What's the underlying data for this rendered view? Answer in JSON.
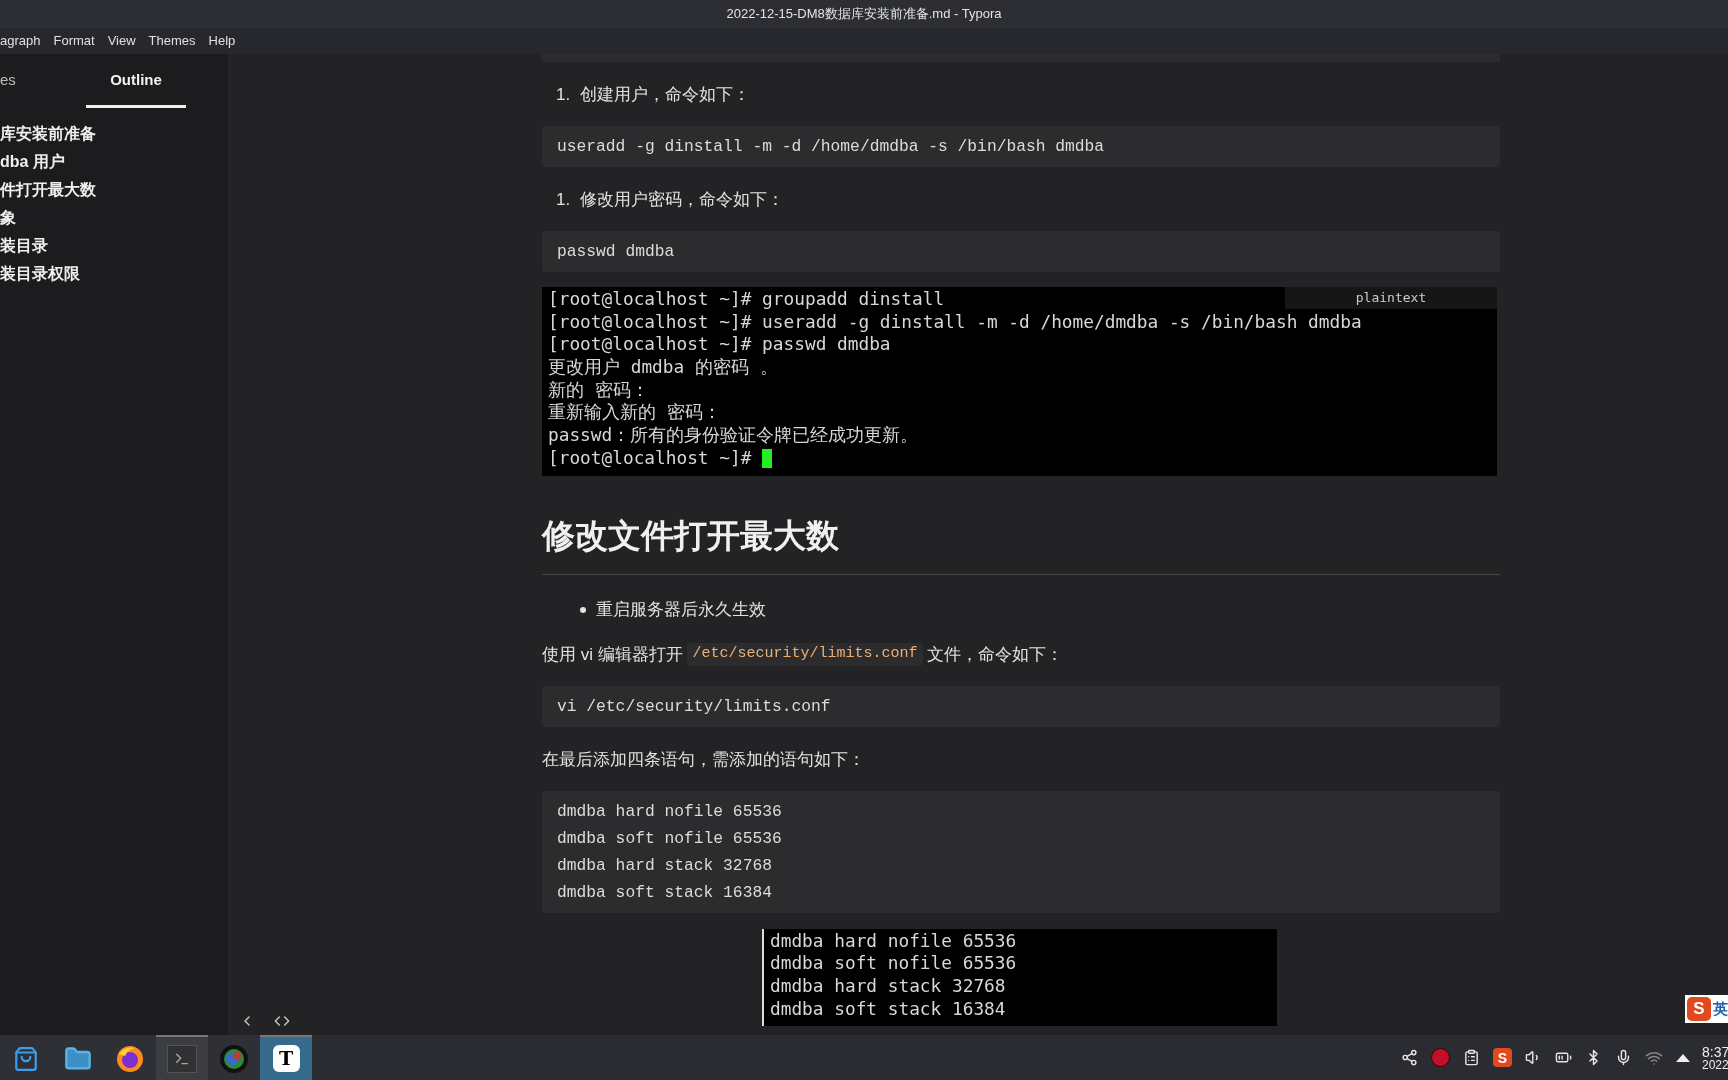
{
  "window": {
    "title": "2022-12-15-DM8数据库安装前准备.md - Typora"
  },
  "menu": [
    "agraph",
    "Format",
    "View",
    "Themes",
    "Help"
  ],
  "sidebar": {
    "tabs": [
      {
        "label": "es",
        "selected": false
      },
      {
        "label": "Outline",
        "selected": true
      }
    ],
    "outline": [
      "库安装前准备",
      "dba 用户",
      "件打开最大数",
      "象",
      "装目录",
      "装目录权限"
    ]
  },
  "document": {
    "blocks": [
      {
        "kind": "code_tail"
      },
      {
        "kind": "list_item",
        "number": "1.",
        "text": "创建用户，命令如下："
      },
      {
        "kind": "code",
        "lines": [
          "useradd -g dinstall -m -d /home/dmdba -s /bin/bash dmdba"
        ]
      },
      {
        "kind": "list_item",
        "number": "1.",
        "text": "修改用户密码，命令如下："
      },
      {
        "kind": "code",
        "lines": [
          "passwd dmdba"
        ]
      },
      {
        "kind": "terminal",
        "label": "plaintext",
        "cursor": true,
        "lines": [
          "[root@localhost ~]# groupadd dinstall",
          "[root@localhost ~]# useradd -g dinstall -m -d /home/dmdba -s /bin/bash dmdba",
          "[root@localhost ~]# passwd dmdba",
          "更改用户 dmdba 的密码 。",
          "新的 密码：",
          "重新输入新的 密码：",
          "passwd：所有的身份验证令牌已经成功更新。",
          "[root@localhost ~]# "
        ]
      },
      {
        "kind": "heading",
        "text": "修改文件打开最大数"
      },
      {
        "kind": "bullet",
        "text": "重启服务器后永久生效"
      },
      {
        "kind": "paragraph",
        "parts": [
          {
            "kind": "text",
            "text": "使用 vi 编辑器打开 "
          },
          {
            "kind": "code",
            "text": "/etc/security/limits.conf"
          },
          {
            "kind": "text",
            "text": " 文件，命令如下："
          }
        ]
      },
      {
        "kind": "code",
        "lines": [
          "vi /etc/security/limits.conf"
        ]
      },
      {
        "kind": "paragraph",
        "parts": [
          {
            "kind": "text",
            "text": "在最后添加四条语句，需添加的语句如下："
          }
        ]
      },
      {
        "kind": "code",
        "lines": [
          "dmdba hard nofile 65536",
          "dmdba soft nofile 65536",
          "dmdba hard stack 32768",
          "dmdba soft stack 16384"
        ]
      },
      {
        "kind": "terminal_small",
        "lines": [
          "dmdba hard nofile 65536",
          "dmdba soft nofile 65536",
          "dmdba hard stack 32768",
          "dmdba soft stack 16384"
        ]
      }
    ]
  },
  "ime": {
    "logo": "S",
    "mode": "英"
  },
  "taskbar": {
    "apps": [
      {
        "kind": "store",
        "open": false,
        "selected": false
      },
      {
        "kind": "files",
        "open": false,
        "selected": false
      },
      {
        "kind": "browser",
        "open": false,
        "selected": false
      },
      {
        "kind": "terminal",
        "open": true,
        "selected": false
      },
      {
        "kind": "camera",
        "open": false,
        "selected": false
      },
      {
        "kind": "typora",
        "label": "T",
        "open": true,
        "selected": true
      }
    ],
    "tray": [
      {
        "kind": "network"
      },
      {
        "kind": "record"
      },
      {
        "kind": "clipboard"
      },
      {
        "kind": "ime",
        "label": "S"
      },
      {
        "kind": "volume"
      },
      {
        "kind": "battery"
      },
      {
        "kind": "bluetooth"
      },
      {
        "kind": "mic"
      },
      {
        "kind": "wifi"
      },
      {
        "kind": "expand"
      }
    ],
    "clock": {
      "time": "8:37",
      "date": "2022"
    }
  }
}
